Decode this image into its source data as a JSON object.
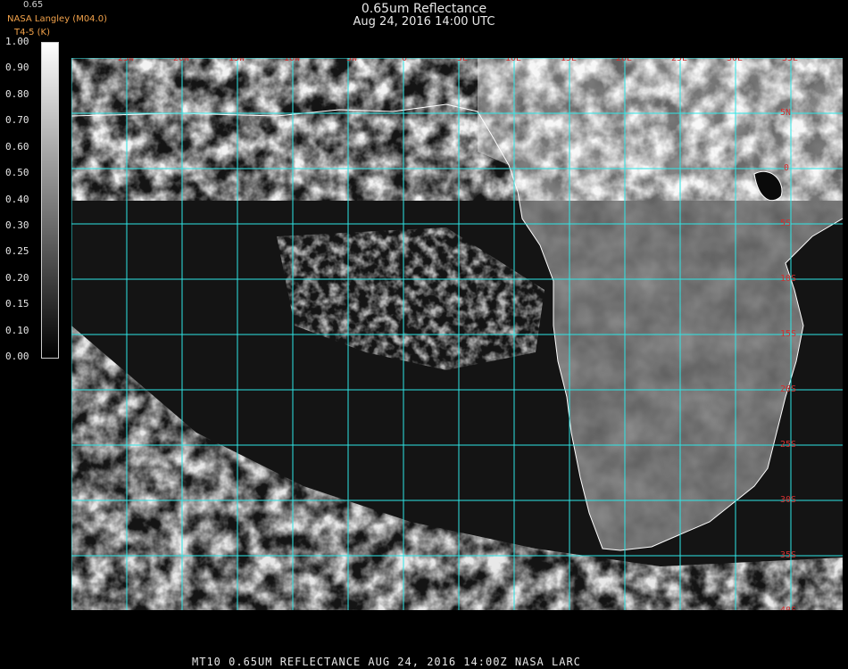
{
  "header": {
    "title": "0.65um Reflectance",
    "datetime": "Aug 24, 2016 14:00 UTC",
    "org": "NASA Langley (M04.0)",
    "temp_label": "T4-5 (K)",
    "band": "0.65"
  },
  "colorbar": {
    "ticks": [
      "1.00",
      "0.90",
      "0.80",
      "0.70",
      "0.60",
      "0.50",
      "0.40",
      "0.30",
      "0.25",
      "0.20",
      "0.15",
      "0.10",
      "0.00"
    ]
  },
  "grid": {
    "lon_labels": [
      "25W",
      "20W",
      "15W",
      "10W",
      "5W",
      "0",
      "5E",
      "10E",
      "15E",
      "20E",
      "25E",
      "30E",
      "35E"
    ],
    "lat_labels": [
      "5N",
      "0",
      "5S",
      "10S",
      "15S",
      "20S",
      "25S",
      "30S",
      "35S",
      "40S"
    ],
    "line_color": "#2ee6e6",
    "label_color": "#d12f2f",
    "coast_color": "#ffffff"
  },
  "footer": {
    "text": "MT10  0.65UM REFLECTANCE   AUG 24, 2016 14:00Z   NASA LARC"
  }
}
